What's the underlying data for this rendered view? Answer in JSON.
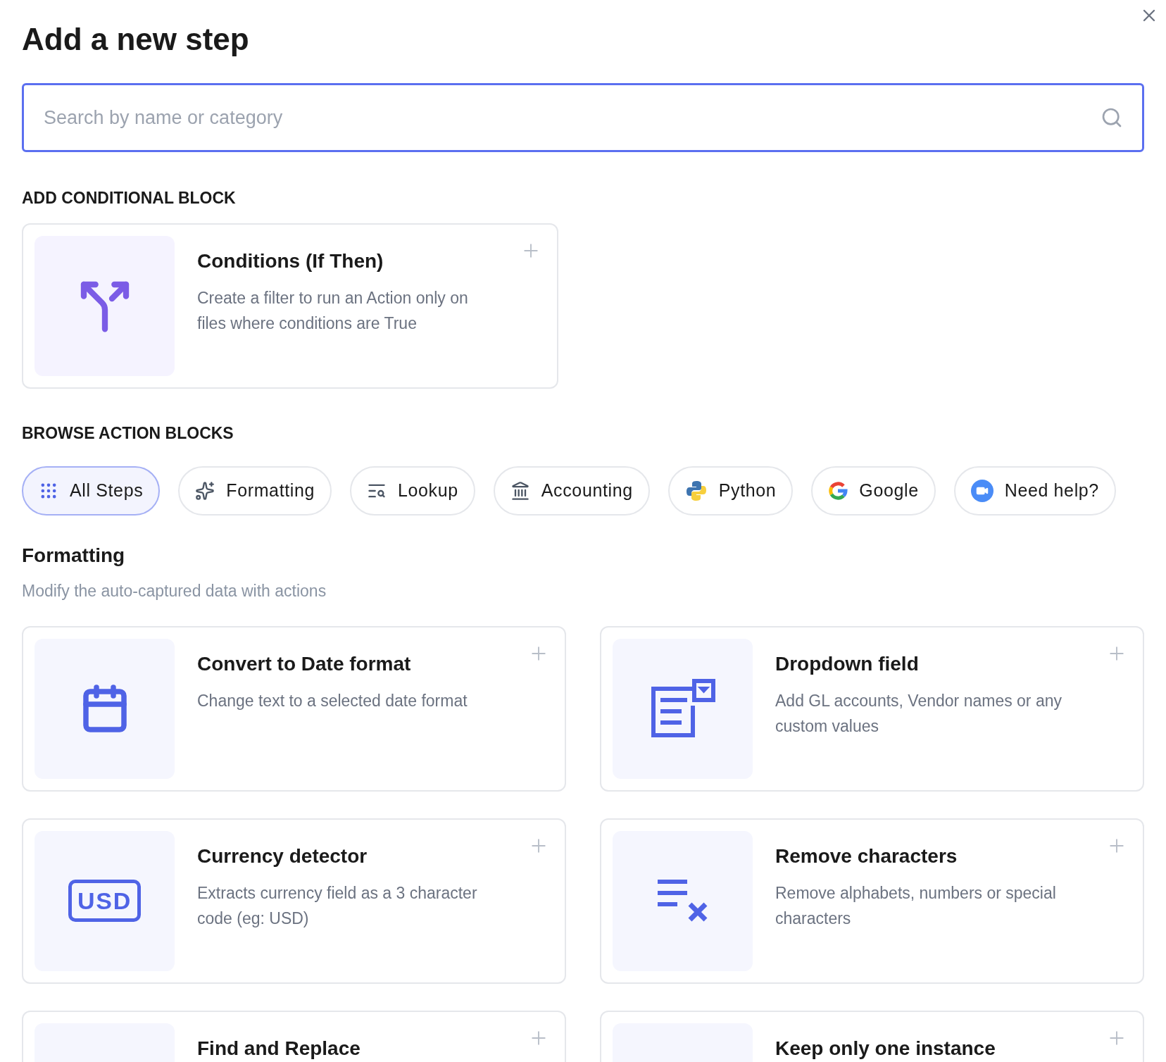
{
  "dialog": {
    "title": "Add a new step"
  },
  "search": {
    "placeholder": "Search by name or category"
  },
  "conditional": {
    "heading": "ADD CONDITIONAL BLOCK",
    "card": {
      "kind": "branch",
      "title": "Conditions (If Then)",
      "description": "Create a filter to run an Action only on files where conditions are True"
    }
  },
  "browse": {
    "heading": "BROWSE ACTION BLOCKS",
    "chips": [
      {
        "kind": "grid",
        "label": "All Steps",
        "selected": true
      },
      {
        "kind": "sparkles",
        "label": "Formatting",
        "selected": false
      },
      {
        "kind": "lookup",
        "label": "Lookup",
        "selected": false
      },
      {
        "kind": "bank",
        "label": "Accounting",
        "selected": false
      },
      {
        "kind": "python",
        "label": "Python",
        "selected": false
      },
      {
        "kind": "google",
        "label": "Google",
        "selected": false
      },
      {
        "kind": "video",
        "label": "Need help?",
        "selected": false
      }
    ]
  },
  "section": {
    "title": "Formatting",
    "subtitle": "Modify the auto-captured data with actions",
    "cards": [
      {
        "kind": "calendar",
        "title": "Convert to Date format",
        "description": "Change text to a selected date format"
      },
      {
        "kind": "dropdown",
        "title": "Dropdown field",
        "description": "Add GL accounts, Vendor names or any custom values"
      },
      {
        "kind": "currency",
        "icon_text": "USD",
        "title": "Currency detector",
        "description": "Extracts currency field as a 3 character code (eg: USD)"
      },
      {
        "kind": "remove",
        "title": "Remove characters",
        "description": "Remove alphabets, numbers or special characters"
      },
      {
        "kind": "blank",
        "title": "Find and Replace"
      },
      {
        "kind": "blank",
        "title": "Keep only one instance"
      }
    ]
  }
}
